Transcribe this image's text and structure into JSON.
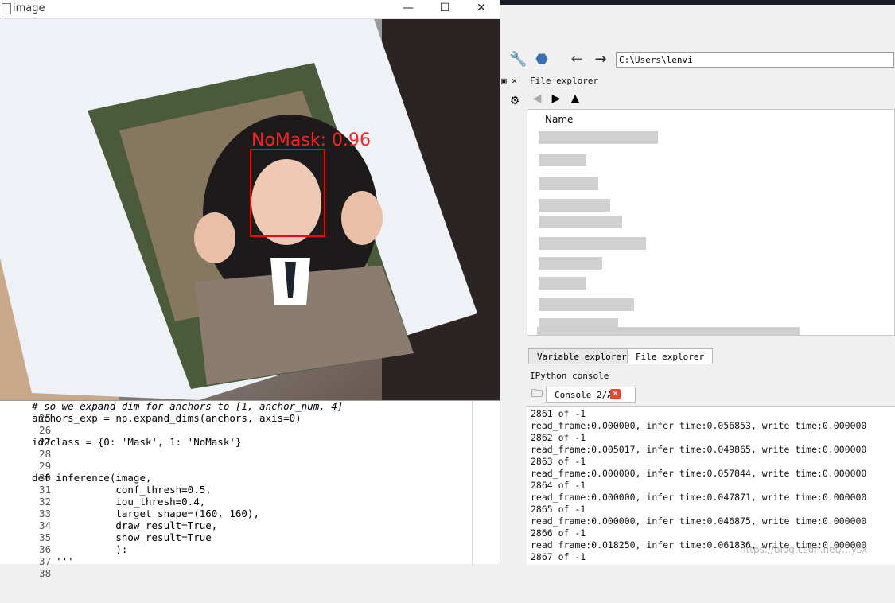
{
  "image_window": {
    "title": "image",
    "minimize": "—",
    "maximize": "☐",
    "close": "✕",
    "detection_label": "NoMask: 0.96",
    "box_color": "#ff0000"
  },
  "editor": {
    "lines": [
      {
        "n": "25",
        "text": "# so we expand dim for anchors to [1, anchor_num, 4]"
      },
      {
        "n": "26",
        "text": "anchors_exp = np.expand_dims(anchors, axis=0)"
      },
      {
        "n": "27",
        "text": ""
      },
      {
        "n": "28",
        "text": "id2class = {0: 'Mask', 1: 'NoMask'}"
      },
      {
        "n": "29",
        "text": ""
      },
      {
        "n": "30",
        "text": ""
      },
      {
        "n": "31",
        "text": "def inference(image,"
      },
      {
        "n": "32",
        "text": "              conf_thresh=0.5,"
      },
      {
        "n": "33",
        "text": "              iou_thresh=0.4,"
      },
      {
        "n": "34",
        "text": "              target_shape=(160, 160),"
      },
      {
        "n": "35",
        "text": "              draw_result=True,"
      },
      {
        "n": "36",
        "text": "              show_result=True"
      },
      {
        "n": "37",
        "text": "              ):"
      },
      {
        "n": "38",
        "text": "    '''"
      }
    ]
  },
  "toolbar": {
    "path": "C:\\Users\\lenvi"
  },
  "file_explorer": {
    "header": "File explorer",
    "column_name": "Name"
  },
  "tabs": {
    "variable_explorer": "Variable explorer",
    "file_explorer": "File explorer"
  },
  "console": {
    "header": "IPython console",
    "tab_label": "Console 2/A",
    "lines": [
      "2861 of -1",
      "read_frame:0.000000, infer time:0.056853, write time:0.000000",
      "2862 of -1",
      "read_frame:0.005017, infer time:0.049865, write time:0.000000",
      "2863 of -1",
      "read_frame:0.000000, infer time:0.057844, write time:0.000000",
      "2864 of -1",
      "read_frame:0.000000, infer time:0.047871, write time:0.000000",
      "2865 of -1",
      "read_frame:0.000000, infer time:0.046875, write time:0.000000",
      "2866 of -1",
      "read_frame:0.018250, infer time:0.061836, write time:0.000000",
      "2867 of -1"
    ]
  },
  "watermark": "https://blog.csdn.net/...ysx"
}
